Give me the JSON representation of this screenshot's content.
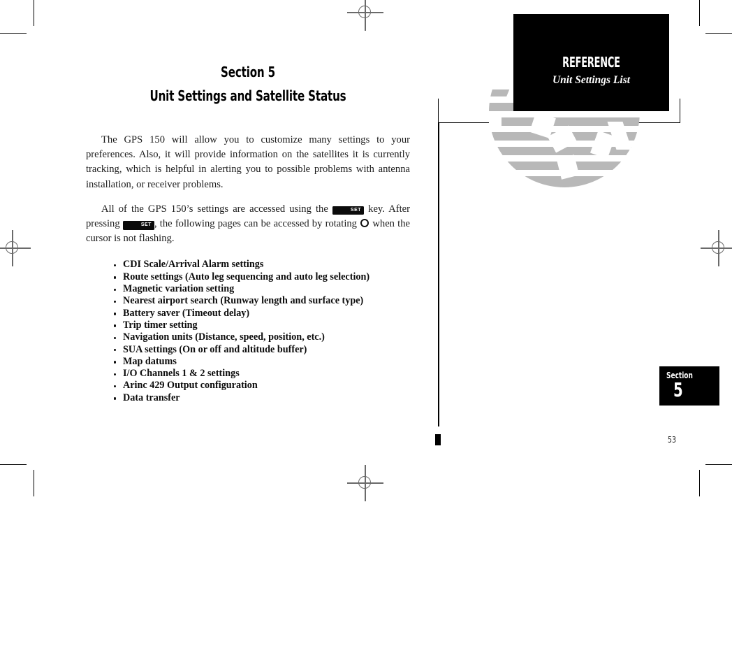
{
  "page": {
    "number": "53",
    "section_tab": {
      "word": "Section",
      "number": "5"
    }
  },
  "header": {
    "kicker": "REFERENCE",
    "subtitle": "Unit Settings List"
  },
  "title": {
    "line1": "Section 5",
    "line2": "Unit Settings and Satellite Status"
  },
  "paragraphs": {
    "intro": "The GPS 150 will allow you to customize many settings to your preferences. Also, it will provide information on the satellites it is currently tracking, which is helpful in alerting you to possible problems with antenna installation, or receiver problems.",
    "access_part1": "All of the GPS 150’s settings are accessed using the ",
    "access_key1": "SET",
    "access_part2": " key. After pressing ",
    "access_key2": "SET",
    "access_part3": ", the following pages can be accessed by rotating ",
    "access_part4": " when the cursor is not flashing."
  },
  "settings_list": [
    "CDI Scale/Arrival Alarm settings",
    "Route settings  (Auto leg sequencing and auto leg selection)",
    "Magnetic variation setting",
    "Nearest airport search  (Runway length and surface type)",
    "Battery saver  (Timeout delay)",
    "Trip timer setting",
    "Navigation units (Distance, speed, position, etc.)",
    "SUA settings (On or off and altitude buffer)",
    "Map datums",
    "I/O Channels 1 & 2 settings",
    "Arinc 429 Output configuration",
    "Data transfer"
  ],
  "colors": {
    "ink": "#000000",
    "paper": "#ffffff",
    "globe_grey": "#b8b8b8",
    "registration_grey": "#6a6a6a"
  }
}
